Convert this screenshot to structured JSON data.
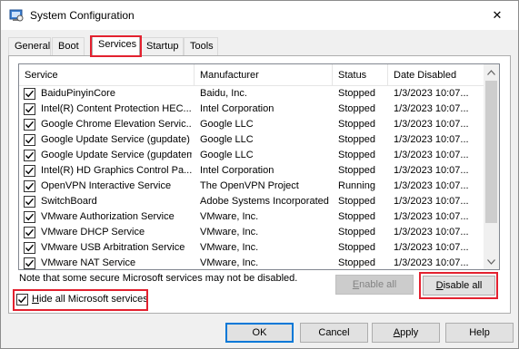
{
  "window": {
    "title": "System Configuration",
    "close_glyph": "✕"
  },
  "tabs": [
    {
      "label": "General"
    },
    {
      "label": "Boot"
    },
    {
      "label": "Services",
      "active": true
    },
    {
      "label": "Startup"
    },
    {
      "label": "Tools"
    }
  ],
  "columns": {
    "service": "Service",
    "manufacturer": "Manufacturer",
    "status": "Status",
    "date_disabled": "Date Disabled"
  },
  "services": [
    {
      "checked": true,
      "name": "BaiduPinyinCore",
      "manufacturer": "Baidu, Inc.",
      "status": "Stopped",
      "date": "1/3/2023 10:07..."
    },
    {
      "checked": true,
      "name": "Intel(R) Content Protection HEC...",
      "manufacturer": "Intel Corporation",
      "status": "Stopped",
      "date": "1/3/2023 10:07..."
    },
    {
      "checked": true,
      "name": "Google Chrome Elevation Servic...",
      "manufacturer": "Google LLC",
      "status": "Stopped",
      "date": "1/3/2023 10:07..."
    },
    {
      "checked": true,
      "name": "Google Update Service (gupdate)",
      "manufacturer": "Google LLC",
      "status": "Stopped",
      "date": "1/3/2023 10:07..."
    },
    {
      "checked": true,
      "name": "Google Update Service (gupdatem)",
      "manufacturer": "Google LLC",
      "status": "Stopped",
      "date": "1/3/2023 10:07..."
    },
    {
      "checked": true,
      "name": "Intel(R) HD Graphics Control Pa...",
      "manufacturer": "Intel Corporation",
      "status": "Stopped",
      "date": "1/3/2023 10:07..."
    },
    {
      "checked": true,
      "name": "OpenVPN Interactive Service",
      "manufacturer": "The OpenVPN Project",
      "status": "Running",
      "date": "1/3/2023 10:07..."
    },
    {
      "checked": true,
      "name": "SwitchBoard",
      "manufacturer": "Adobe Systems Incorporated",
      "status": "Stopped",
      "date": "1/3/2023 10:07..."
    },
    {
      "checked": true,
      "name": "VMware Authorization Service",
      "manufacturer": "VMware, Inc.",
      "status": "Stopped",
      "date": "1/3/2023 10:07..."
    },
    {
      "checked": true,
      "name": "VMware DHCP Service",
      "manufacturer": "VMware, Inc.",
      "status": "Stopped",
      "date": "1/3/2023 10:07..."
    },
    {
      "checked": true,
      "name": "VMware USB Arbitration Service",
      "manufacturer": "VMware, Inc.",
      "status": "Stopped",
      "date": "1/3/2023 10:07..."
    },
    {
      "checked": true,
      "name": "VMware NAT Service",
      "manufacturer": "VMware, Inc.",
      "status": "Stopped",
      "date": "1/3/2023 10:07..."
    }
  ],
  "note": "Note that some secure Microsoft services may not be disabled.",
  "buttons": {
    "enable_all": {
      "pre": "",
      "accel": "E",
      "post": "nable all"
    },
    "disable_all": {
      "pre": "",
      "accel": "D",
      "post": "isable all"
    },
    "ok": "OK",
    "cancel": "Cancel",
    "apply": {
      "pre": "",
      "accel": "A",
      "post": "pply"
    },
    "help": "Help"
  },
  "hide_microsoft": {
    "checked": true,
    "pre": "",
    "accel": "H",
    "post": "ide all Microsoft services"
  },
  "colors": {
    "highlight": "#e3212f",
    "default_button_border": "#0078d7"
  }
}
